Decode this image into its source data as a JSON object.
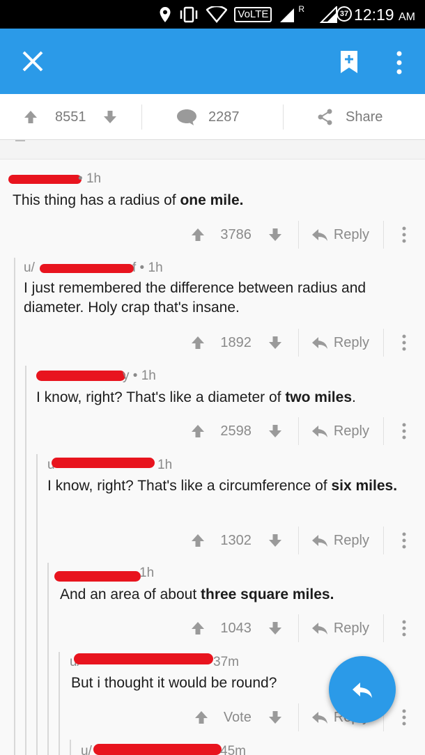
{
  "status_bar": {
    "network_label": "VoLTE",
    "roaming": "R",
    "battery": "37",
    "time": "12:19",
    "ampm": "AM"
  },
  "post_actions": {
    "upvotes": "8551",
    "comments": "2287",
    "share_label": "Share"
  },
  "comments": [
    {
      "time": "1h",
      "body_plain": "This thing has a radius of ",
      "body_bold": "one mile.",
      "body_after": "",
      "score": "3786",
      "reply_label": "Reply"
    },
    {
      "user_prefix": "u/",
      "user_suffix": "f",
      "time": "1h",
      "body_plain": "I just remembered the difference between radius and diameter. Holy crap that's insane.",
      "body_bold": "",
      "body_after": "",
      "score": "1892",
      "reply_label": "Reply"
    },
    {
      "user_suffix": "y",
      "time": "1h",
      "body_plain": "I know, right? That's like a diameter of ",
      "body_bold": "two miles",
      "body_after": ".",
      "score": "2598",
      "reply_label": "Reply"
    },
    {
      "user_prefix": "u",
      "time": "1h",
      "body_plain": "I know, right? That's like a circumference of ",
      "body_bold": "six miles.",
      "body_after": "",
      "score": "1302",
      "reply_label": "Reply"
    },
    {
      "time": "1h",
      "body_plain": "And an area of about ",
      "body_bold": "three square miles.",
      "body_after": "",
      "score": "1043",
      "reply_label": "Reply"
    },
    {
      "user_prefix": "u/",
      "time": "37m",
      "body_plain": "But i thought it would be round?",
      "body_bold": "",
      "body_after": "",
      "score": "Vote",
      "reply_label": "Reply"
    },
    {
      "user_prefix": "u/",
      "time": "45m"
    }
  ]
}
